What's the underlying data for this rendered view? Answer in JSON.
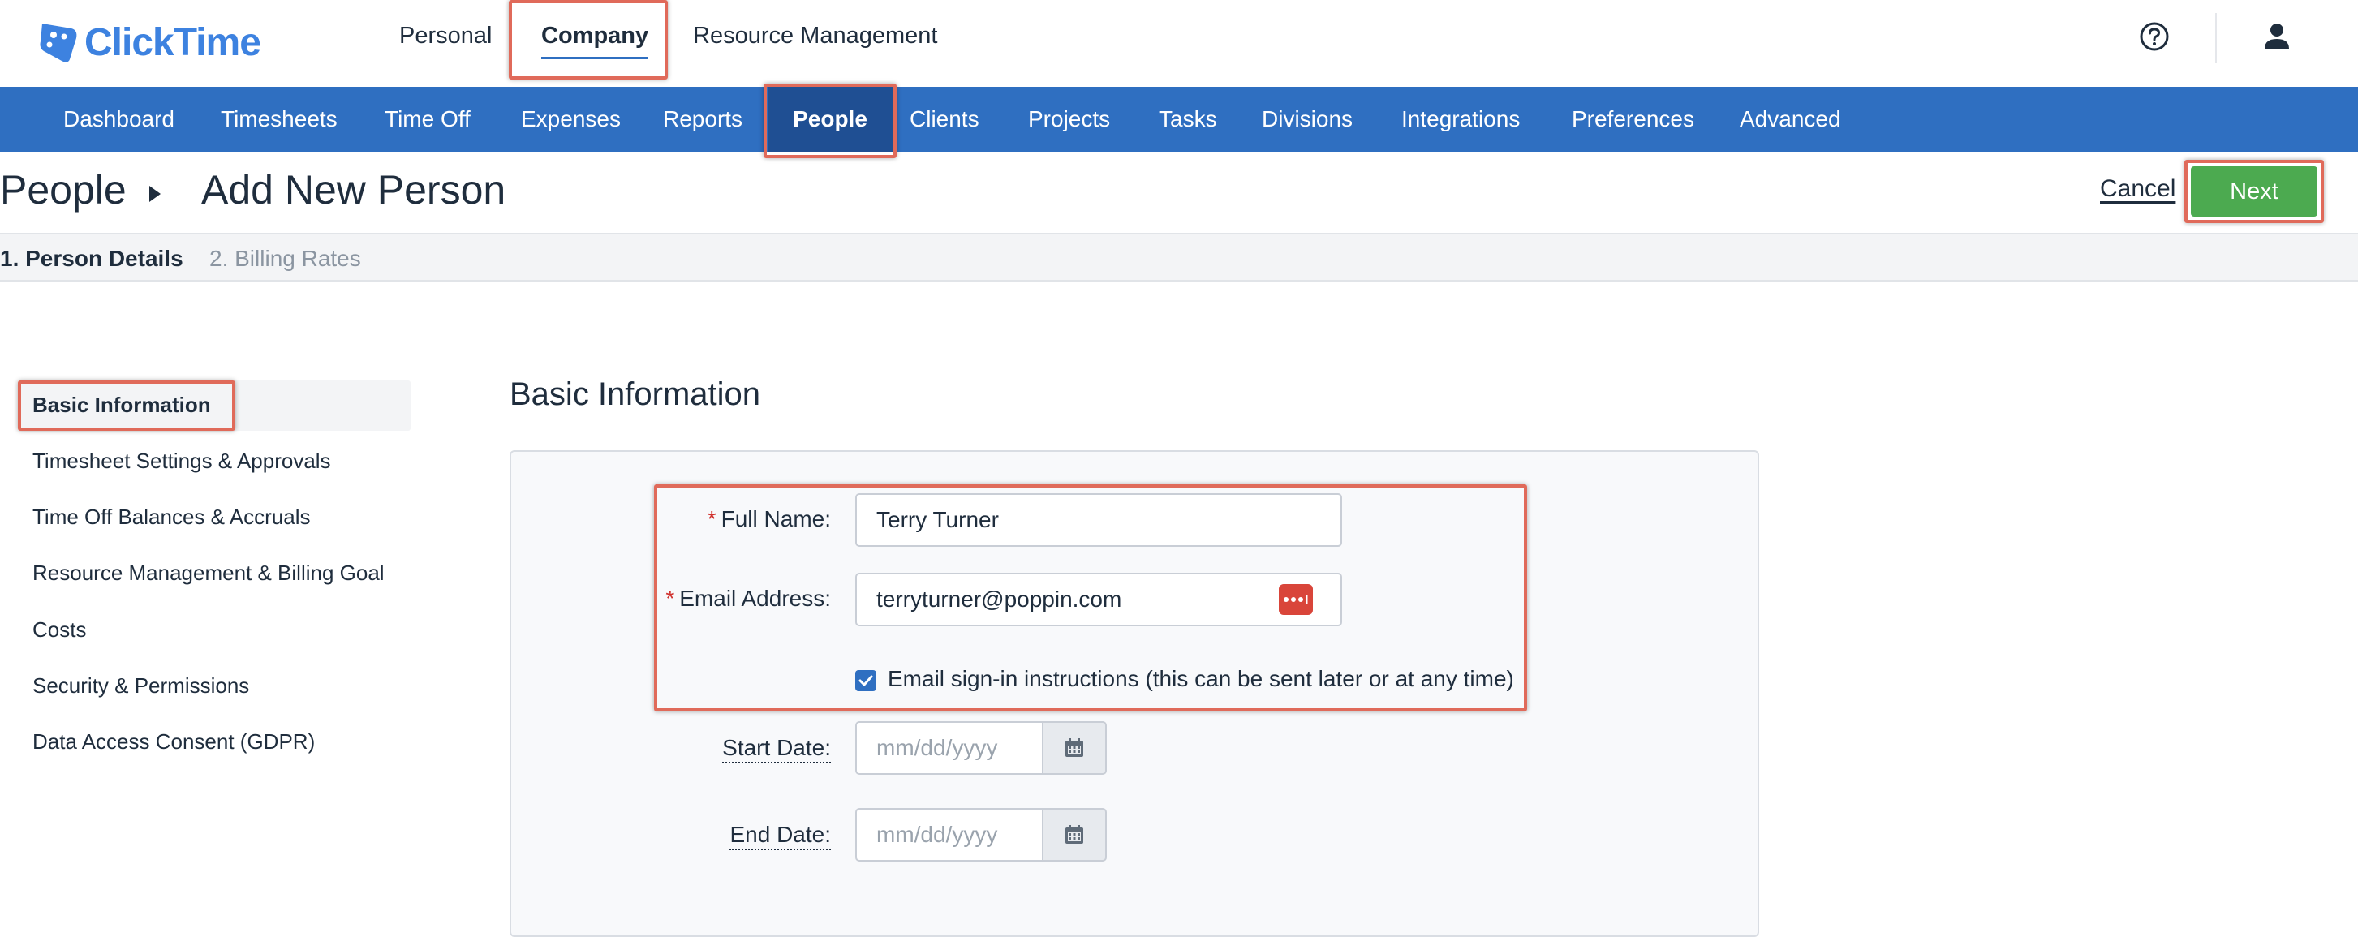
{
  "brand": {
    "logo_text": "ClickTime",
    "color": "#3d82e0"
  },
  "top_nav": {
    "items": [
      {
        "label": "Personal",
        "active": false
      },
      {
        "label": "Company",
        "active": true
      },
      {
        "label": "Resource Management",
        "active": false
      }
    ],
    "help_icon": "question-circle-icon",
    "user_icon": "user-icon"
  },
  "main_nav": {
    "items": [
      {
        "label": "Dashboard"
      },
      {
        "label": "Timesheets"
      },
      {
        "label": "Time Off"
      },
      {
        "label": "Expenses"
      },
      {
        "label": "Reports"
      },
      {
        "label": "People",
        "active": true
      },
      {
        "label": "Clients"
      },
      {
        "label": "Projects"
      },
      {
        "label": "Tasks"
      },
      {
        "label": "Divisions"
      },
      {
        "label": "Integrations"
      },
      {
        "label": "Preferences"
      },
      {
        "label": "Advanced"
      }
    ],
    "bg_color": "#2f6fc1",
    "active_bg_color": "#1f4f93"
  },
  "page_header": {
    "breadcrumb_root": "People",
    "breadcrumb_current": "Add New Person",
    "cancel_label": "Cancel",
    "next_label": "Next"
  },
  "steps": [
    {
      "label": "1. Person Details",
      "active": true
    },
    {
      "label": "2. Billing Rates",
      "active": false
    }
  ],
  "sidebar": {
    "items": [
      {
        "label": "Basic Information",
        "active": true
      },
      {
        "label": "Timesheet Settings & Approvals"
      },
      {
        "label": "Time Off Balances & Accruals"
      },
      {
        "label": "Resource Management & Billing Goal"
      },
      {
        "label": "Costs"
      },
      {
        "label": "Security & Permissions"
      },
      {
        "label": "Data Access Consent (GDPR)"
      }
    ]
  },
  "form": {
    "section_title": "Basic Information",
    "full_name": {
      "label": "Full Name:",
      "value": "Terry Turner",
      "required": true
    },
    "email": {
      "label": "Email Address:",
      "value": "terryturner@poppin.com",
      "required": true
    },
    "email_signin": {
      "label": "Email sign-in instructions (this can be sent later or at any time)",
      "checked": true
    },
    "start_date": {
      "label": "Start Date:",
      "placeholder": "mm/dd/yyyy"
    },
    "end_date": {
      "label": "End Date:",
      "placeholder": "mm/dd/yyyy"
    },
    "required_marker": "*"
  },
  "colors": {
    "accent_blue": "#2f6fc1",
    "next_green": "#4caa50",
    "required_red": "#d0312d",
    "highlight": "#e06a5a"
  }
}
